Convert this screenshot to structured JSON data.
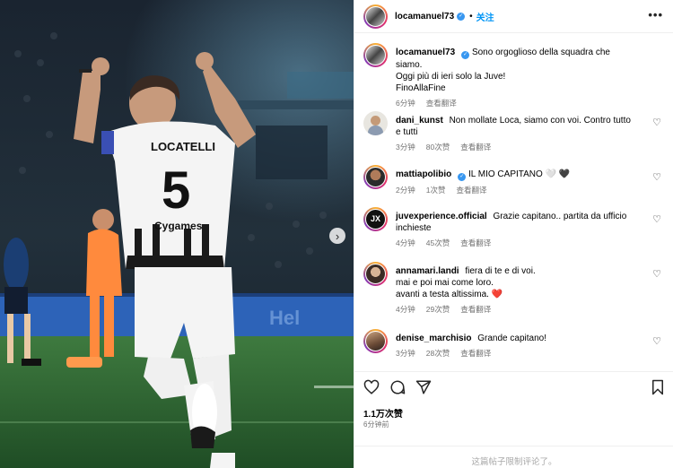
{
  "post": {
    "author": "locamanuel73",
    "follow_label": "关注",
    "more_label": "•••",
    "caption": {
      "line1": "Sono orgoglioso della squadra che siamo.",
      "line2": "Oggi più di ieri solo la Juve!",
      "line3": "FinoAllaFine",
      "time": "6分钟",
      "translate": "查看翻译"
    },
    "photo": {
      "player_name": "LOCATELLI",
      "player_number": "5",
      "sponsor": "Cygames"
    }
  },
  "comments": [
    {
      "user": "dani_kunst",
      "verified": false,
      "text": "Non mollate Loca, siamo con voi. Contro tutto e tutti",
      "time": "3分钟",
      "likes": "80次赞",
      "translate": "查看翻译"
    },
    {
      "user": "mattiapolibio",
      "verified": true,
      "text": "IL MIO CAPITANO 🤍 🖤",
      "time": "2分钟",
      "likes": "1次赞",
      "translate": "查看翻译"
    },
    {
      "user": "juvexperience.official",
      "verified": false,
      "text": "Grazie capitano.. partita da ufficio inchieste",
      "time": "4分钟",
      "likes": "45次赞",
      "translate": "查看翻译"
    },
    {
      "user": "annamari.landi",
      "verified": false,
      "text_line1": "fiera di te e di voi.",
      "text_line2": "mai e poi mai come loro.",
      "text_line3": "avanti a testa altissima. ❤️",
      "time": "4分钟",
      "likes": "29次赞",
      "translate": "查看翻译"
    },
    {
      "user": "denise_marchisio",
      "verified": false,
      "text": "Grande capitano!",
      "time": "3分钟",
      "likes": "28次赞",
      "translate": "查看翻译"
    }
  ],
  "actions": {
    "likes": "1.1万次赞",
    "ago": "6分钟前",
    "comments_limited": "这篇帖子限制评论了。"
  },
  "icons": {
    "like": "heart-icon",
    "comment": "comment-icon",
    "share": "share-icon",
    "save": "bookmark-icon",
    "carousel_next": "chevron-right-icon"
  }
}
